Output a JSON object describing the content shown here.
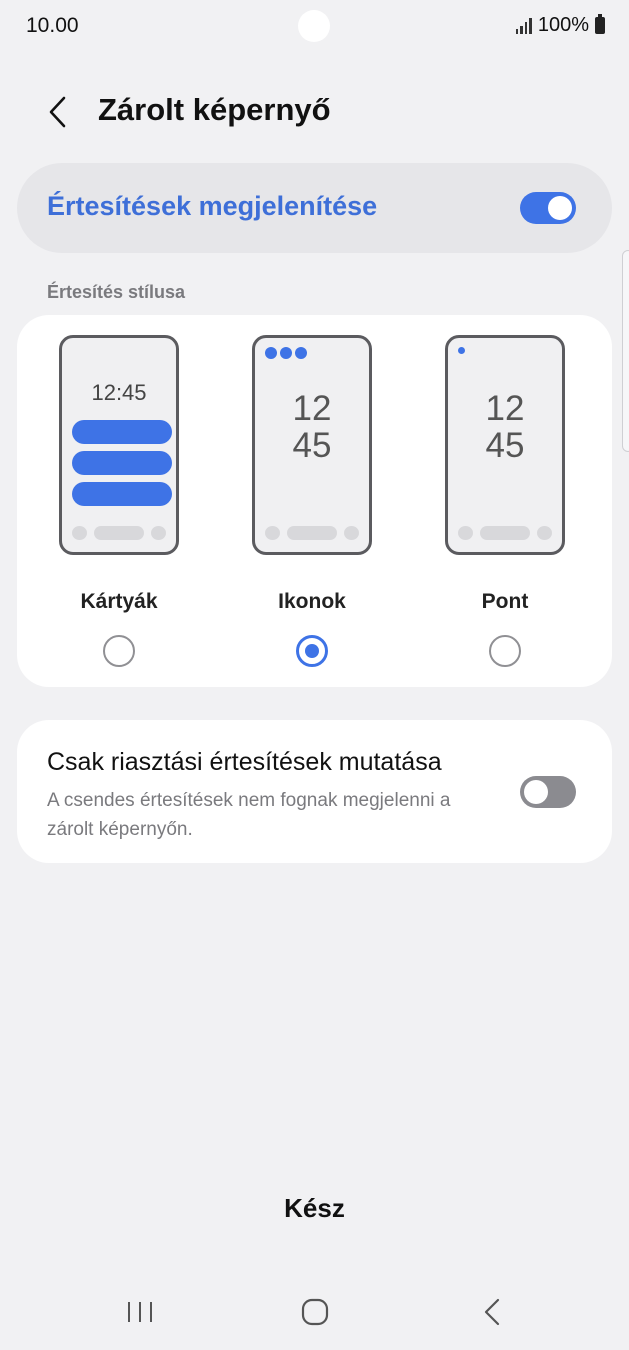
{
  "status": {
    "time": "10.00",
    "battery": "100%"
  },
  "header": {
    "title": "Zárolt képernyő",
    "back_icon": "chevron-left-icon"
  },
  "master_toggle": {
    "label": "Értesítések megjelenítése",
    "state": "on"
  },
  "section": {
    "label": "Értesítés stílusa"
  },
  "styles": {
    "selected": "Ikonok",
    "options": [
      {
        "label": "Kártyák",
        "clock": "12:45"
      },
      {
        "label": "Ikonok",
        "clock_hour": "12",
        "clock_min": "45"
      },
      {
        "label": "Pont",
        "clock_hour": "12",
        "clock_min": "45"
      }
    ]
  },
  "alert_only": {
    "title": "Csak riasztási értesítések mutatása",
    "description": "A csendes értesítések nem fognak megjelenni a zárolt képernyőn.",
    "state": "off"
  },
  "footer": {
    "done_label": "Kész"
  },
  "navbar": {
    "recents_icon": "recents-icon",
    "home_icon": "home-icon",
    "back_icon": "back-icon"
  },
  "colors": {
    "accent": "#3e73e6",
    "background": "#f1f1f3",
    "card": "#ffffff"
  }
}
